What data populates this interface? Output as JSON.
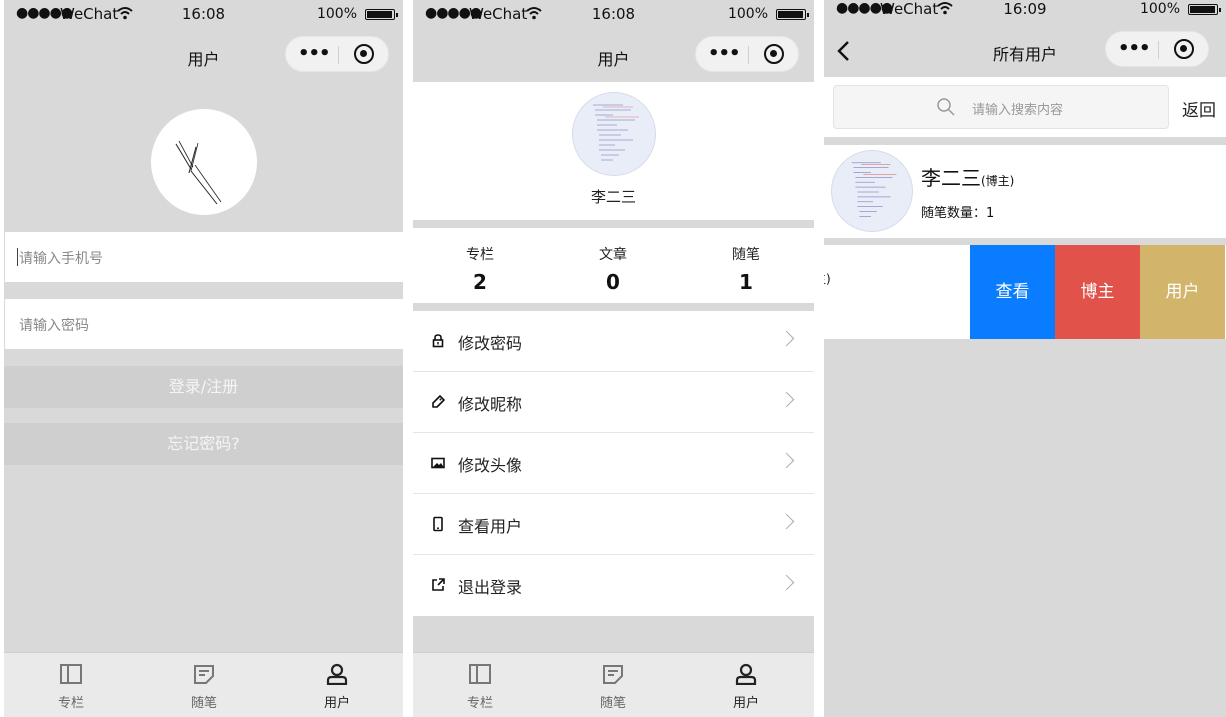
{
  "status": {
    "signal": "●●●●●",
    "carrier": "WeChat",
    "battery": "100%",
    "time_1": "16:08",
    "time_2": "16:08",
    "time_3": "16:09"
  },
  "capsule": {
    "more": "•••"
  },
  "login_screen": {
    "title": "用户",
    "phone_placeholder": "请输入手机号",
    "password_placeholder": "请输入密码",
    "login_button": "登录/注册",
    "forgot_button": "忘记密码?"
  },
  "profile_screen": {
    "title": "用户",
    "username": "李二三",
    "stats": [
      {
        "label": "专栏",
        "value": "2"
      },
      {
        "label": "文章",
        "value": "0"
      },
      {
        "label": "随笔",
        "value": "1"
      }
    ],
    "menu": [
      {
        "label": "修改密码",
        "icon": "lock-icon"
      },
      {
        "label": "修改昵称",
        "icon": "tag-icon"
      },
      {
        "label": "修改头像",
        "icon": "image-icon"
      },
      {
        "label": "查看用户",
        "icon": "phone-icon"
      },
      {
        "label": "退出登录",
        "icon": "external-link-icon"
      }
    ]
  },
  "users_screen": {
    "title": "所有用户",
    "search_placeholder": "请输入搜索内容",
    "back_button": "返回",
    "user": {
      "name": "李二三",
      "role": "(博主)",
      "essay_count_label": "随笔数量：1"
    },
    "partial_text": "主)",
    "actions": [
      {
        "label": "查看",
        "color": "#0a7cff"
      },
      {
        "label": "博主",
        "color": "#e0524a"
      },
      {
        "label": "用户",
        "color": "#d2b56b"
      }
    ]
  },
  "tabbar": {
    "items": [
      {
        "label": "专栏",
        "icon": "column-icon"
      },
      {
        "label": "随笔",
        "icon": "note-icon"
      },
      {
        "label": "用户",
        "icon": "user-icon"
      }
    ],
    "active_index": 2
  },
  "colors": {
    "background": "#d9d9d9",
    "view_action": "#0a7cff",
    "blogger_action": "#e0524a",
    "user_action": "#d2b56b"
  }
}
